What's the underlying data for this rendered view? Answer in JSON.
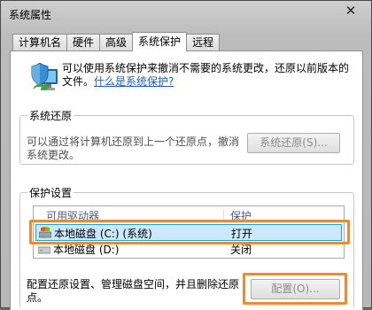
{
  "window": {
    "title": "系统属性",
    "close_glyph": "✕"
  },
  "tabs": [
    {
      "label": "计算机名",
      "active": false
    },
    {
      "label": "硬件",
      "active": false
    },
    {
      "label": "高级",
      "active": false
    },
    {
      "label": "系统保护",
      "active": true
    },
    {
      "label": "远程",
      "active": false
    }
  ],
  "intro": {
    "text": "可以使用系统保护来撤消不需要的系统更改，还原以前版本的文件。",
    "link": "什么是系统保护?"
  },
  "system_restore": {
    "title": "系统还原",
    "text": "可以通过将计算机还原到上一个还原点，撤消系统更改。",
    "button": "系统还原(S)..."
  },
  "protection_settings": {
    "title": "保护设置",
    "columns": [
      "可用驱动器",
      "保护"
    ],
    "drives": [
      {
        "name": "本地磁盘 (C:) (系统)",
        "protection": "打开",
        "selected": true
      },
      {
        "name": "本地磁盘 (D:)",
        "protection": "关闭",
        "selected": false
      }
    ],
    "config_text": "配置还原设置、管理磁盘空间，并且删除还原点。",
    "config_button": "配置(O)..."
  },
  "colors": {
    "highlight": "#ef8a2e",
    "selection_bg": "#cce8ff",
    "link": "#1c5fb5"
  },
  "icons": [
    "system-protection-shield-icon",
    "close-icon",
    "drive-icon"
  ]
}
